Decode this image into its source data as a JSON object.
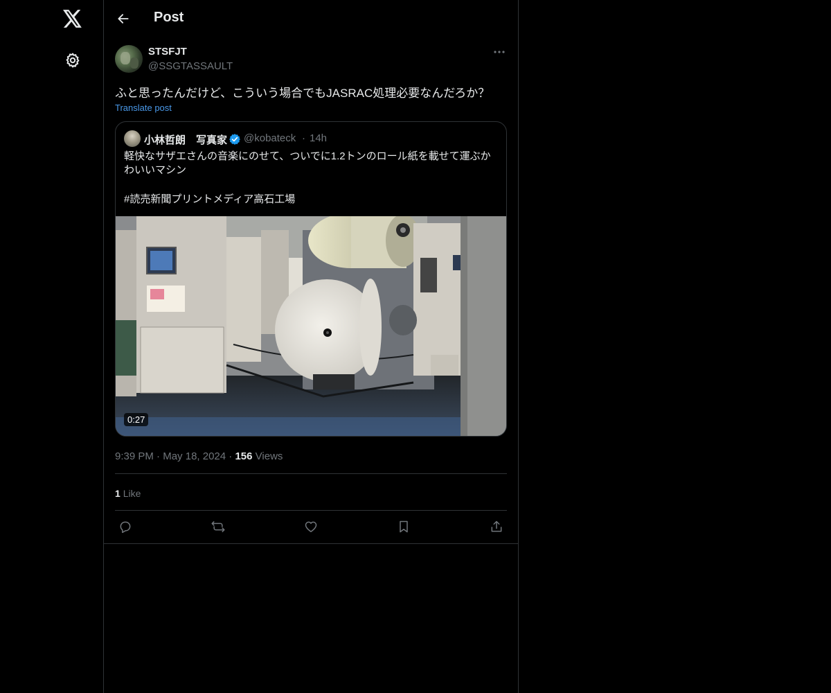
{
  "header": {
    "title": "Post"
  },
  "post": {
    "display_name": "STSFJT",
    "handle": "@SSGTASSAULT",
    "text": "ふと思ったんだけど、こういう場合でもJASRAC処理必要なんだろか？",
    "translate_label": "Translate post",
    "quote": {
      "display_name": "小林哲朗　写真家",
      "handle": "@kobateck",
      "separator": "·",
      "time": "14h",
      "text_line1": "軽快なサザエさんの音楽にのせて、ついでに1.2トンのロール紙を載せて運ぶか",
      "text_line2": "わいいマシン",
      "hashtag": "#読売新聞プリントメディア高石工場",
      "video_duration": "0:27"
    },
    "meta": {
      "time": "9:39 PM",
      "date": "May 18, 2024",
      "separator": "·",
      "views_count": "156",
      "views_label": "Views"
    },
    "likes": {
      "count": "1",
      "label": "Like"
    }
  },
  "icons": [
    "x-logo-icon",
    "gear-icon",
    "back-arrow-icon",
    "more-icon",
    "verified-icon",
    "reply-icon",
    "repost-icon",
    "like-icon",
    "bookmark-icon",
    "share-icon"
  ],
  "colors": {
    "background": "#000000",
    "text": "#e7e9ea",
    "secondary": "#71767b",
    "link": "#4a99e9",
    "border": "#2f3336",
    "verified": "#1d9bf0"
  }
}
